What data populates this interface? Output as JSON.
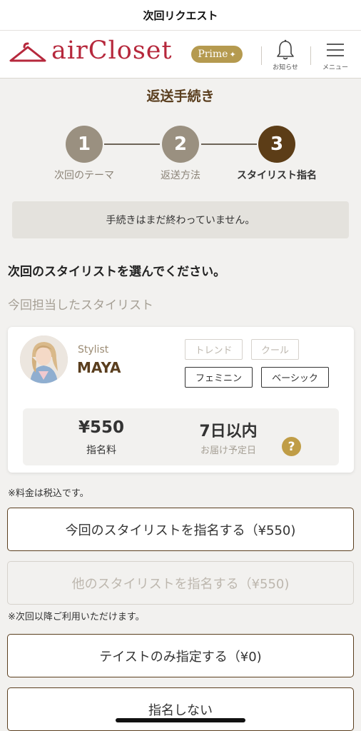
{
  "statusbar": {
    "title": "次回リクエスト"
  },
  "header": {
    "logo_text": "airCloset",
    "prime_label": "Prime",
    "prime_spark": "✦",
    "bell_label": "お知らせ",
    "menu_label": "メニュー",
    "brand_color": "#b6283c",
    "prime_color": "#b59a4f"
  },
  "page": {
    "title": "返送手続き"
  },
  "steps": [
    {
      "number": "1",
      "label": "次回のテーマ",
      "state": "done",
      "color": "#9a9080"
    },
    {
      "number": "2",
      "label": "返送方法",
      "state": "done",
      "color": "#9a9080"
    },
    {
      "number": "3",
      "label": "スタイリスト指名",
      "state": "active",
      "color": "#5c3d17"
    }
  ],
  "notice": {
    "text": "手続きはまだ終わっていません。"
  },
  "section": {
    "title": "次回のスタイリストを選んでください。",
    "subtitle": "今回担当したスタイリスト"
  },
  "stylist_card": {
    "caption": "Stylist",
    "name": "MAYA",
    "tags": [
      {
        "label": "トレンド",
        "selected": false
      },
      {
        "label": "クール",
        "selected": false
      },
      {
        "label": "フェミニン",
        "selected": true
      },
      {
        "label": "ベーシック",
        "selected": true
      }
    ],
    "price": "¥550",
    "price_label": "指名料",
    "delivery": "7日以内",
    "delivery_label": "お届け予定日",
    "help_icon": "?"
  },
  "notes": {
    "tax_note": "※料金は税込です。",
    "next_note": "※次回以降ご利用いただけます。"
  },
  "buttons": {
    "designate_current": "今回のスタイリストを指名する（¥550)",
    "designate_other": "他のスタイリストを指名する（¥550)",
    "taste_only": "テイストのみ指定する（¥0)",
    "no_designation": "指名しない"
  },
  "icons": {
    "hanger": "hanger-logo-icon",
    "bell": "bell-icon",
    "menu": "hamburger-menu-icon",
    "help": "question-icon"
  },
  "accent_colors": {
    "title": "#5a3e1e",
    "button_border": "#5a3e1e",
    "help": "#c09d46"
  }
}
